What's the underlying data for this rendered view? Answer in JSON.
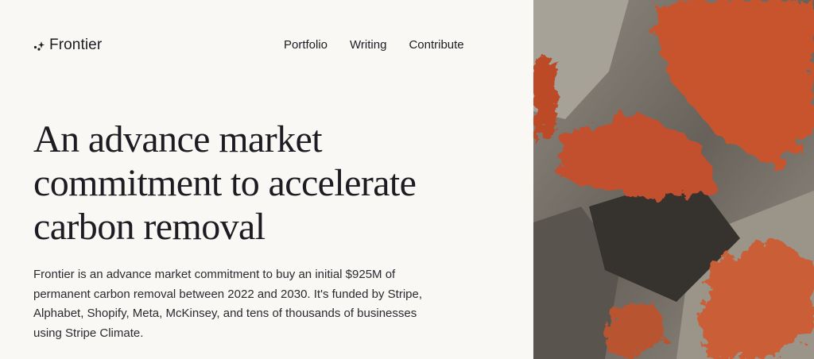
{
  "brand": {
    "name": "Frontier",
    "logo_icon": "sparkle-dots-icon"
  },
  "nav": {
    "items": [
      {
        "label": "Portfolio"
      },
      {
        "label": "Writing"
      },
      {
        "label": "Contribute"
      }
    ]
  },
  "hero": {
    "headline": "An advance market commitment to accelerate carbon removal",
    "description": "Frontier is an advance market commitment to buy an initial $925M of permanent carbon removal between 2022 and 2030. It's funded by Stripe, Alphabet, Shopify, Meta, McKinsey, and tens of thousands of businesses using Stripe Climate."
  },
  "colors": {
    "background": "#faf8f4",
    "text": "#1c1c22",
    "rock_orange": "#d9582f",
    "rock_grey": "#8d877f"
  }
}
